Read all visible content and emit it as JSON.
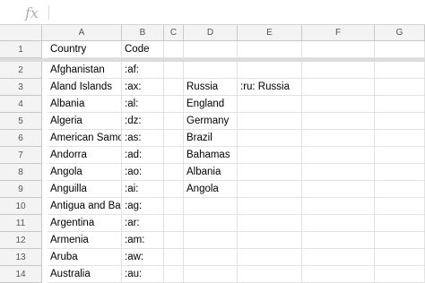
{
  "formula_bar": {
    "fx_label": "fx",
    "value": ""
  },
  "columns": [
    "A",
    "B",
    "C",
    "D",
    "E",
    "F",
    "G"
  ],
  "rows": [
    {
      "num": "1",
      "A": "Country",
      "B": "Code",
      "C": "",
      "D": "",
      "E": "",
      "F": "",
      "G": ""
    },
    {
      "num": "2",
      "A": "Afghanistan",
      "B": ":af:",
      "C": "",
      "D": "",
      "E": "",
      "F": "",
      "G": ""
    },
    {
      "num": "3",
      "A": "Aland Islands",
      "B": ":ax:",
      "C": "",
      "D": "Russia",
      "E": ":ru: Russia",
      "F": "",
      "G": ""
    },
    {
      "num": "4",
      "A": "Albania",
      "B": ":al:",
      "C": "",
      "D": "England",
      "E": "",
      "F": "",
      "G": ""
    },
    {
      "num": "5",
      "A": "Algeria",
      "B": ":dz:",
      "C": "",
      "D": "Germany",
      "E": "",
      "F": "",
      "G": ""
    },
    {
      "num": "6",
      "A": "American Samoa",
      "B": ":as:",
      "C": "",
      "D": "Brazil",
      "E": "",
      "F": "",
      "G": ""
    },
    {
      "num": "7",
      "A": "Andorra",
      "B": ":ad:",
      "C": "",
      "D": "Bahamas",
      "E": "",
      "F": "",
      "G": ""
    },
    {
      "num": "8",
      "A": "Angola",
      "B": ":ao:",
      "C": "",
      "D": "Albania",
      "E": "",
      "F": "",
      "G": ""
    },
    {
      "num": "9",
      "A": "Anguilla",
      "B": ":ai:",
      "C": "",
      "D": "Angola",
      "E": "",
      "F": "",
      "G": ""
    },
    {
      "num": "10",
      "A": "Antigua and Barb",
      "B": ":ag:",
      "C": "",
      "D": "",
      "E": "",
      "F": "",
      "G": ""
    },
    {
      "num": "11",
      "A": "Argentina",
      "B": ":ar:",
      "C": "",
      "D": "",
      "E": "",
      "F": "",
      "G": ""
    },
    {
      "num": "12",
      "A": "Armenia",
      "B": ":am:",
      "C": "",
      "D": "",
      "E": "",
      "F": "",
      "G": ""
    },
    {
      "num": "13",
      "A": "Aruba",
      "B": ":aw:",
      "C": "",
      "D": "",
      "E": "",
      "F": "",
      "G": ""
    },
    {
      "num": "14",
      "A": "Australia",
      "B": ":au:",
      "C": "",
      "D": "",
      "E": "",
      "F": "",
      "G": ""
    }
  ]
}
